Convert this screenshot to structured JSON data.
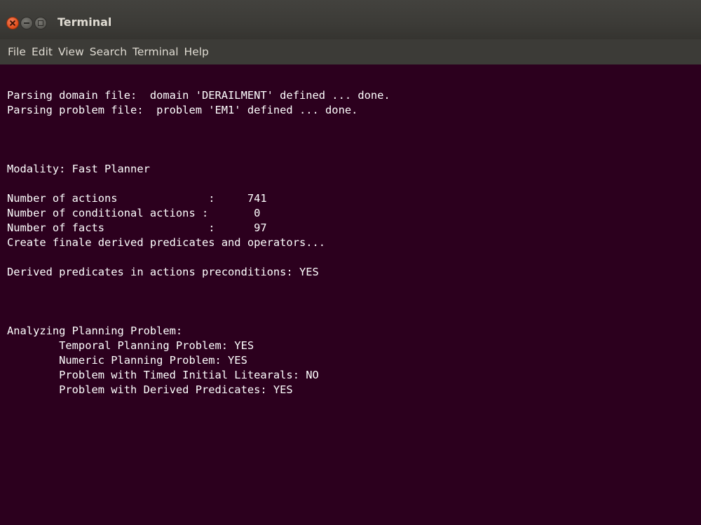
{
  "window": {
    "title": "Terminal",
    "buttons": [
      "close",
      "minimize",
      "maximize"
    ]
  },
  "menu": [
    "File",
    "Edit",
    "View",
    "Search",
    "Terminal",
    "Help"
  ],
  "colors": {
    "terminal_bg": "#2c001e",
    "terminal_fg": "#ffffff",
    "titlebar_bg": "#3c3b37",
    "close_button": "#df4a16"
  },
  "terminal": {
    "lines": [
      "Parsing domain file:  domain 'DERAILMENT' defined ... done.",
      "Parsing problem file:  problem 'EM1' defined ... done.",
      "",
      "",
      "",
      "Modality: Fast Planner",
      "",
      "Number of actions              :     741",
      "Number of conditional actions :       0",
      "Number of facts                :      97",
      "Create finale derived predicates and operators...",
      "",
      "Derived predicates in actions preconditions: YES",
      "",
      "",
      "",
      "Analyzing Planning Problem:",
      "        Temporal Planning Problem: YES",
      "        Numeric Planning Problem: YES",
      "        Problem with Timed Initial Litearals: NO",
      "        Problem with Derived Predicates: YES"
    ]
  }
}
